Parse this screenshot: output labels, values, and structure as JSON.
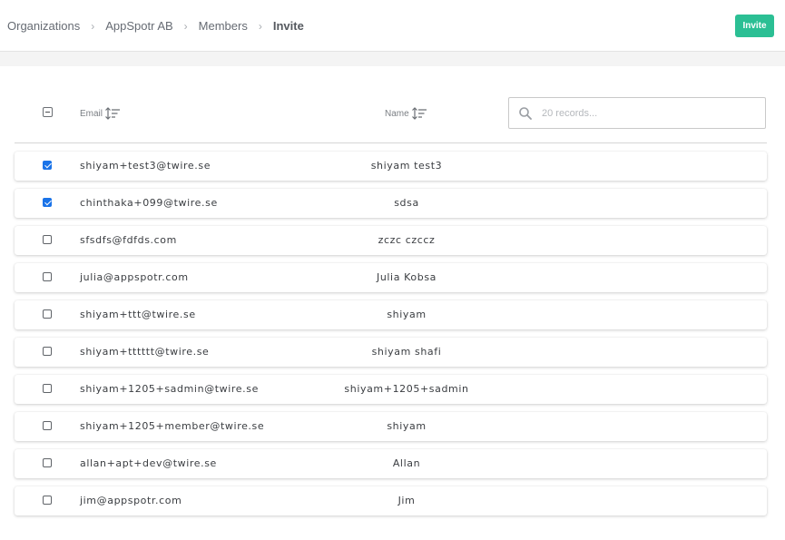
{
  "breadcrumb": {
    "items": [
      "Organizations",
      "AppSpotr AB",
      "Members"
    ],
    "current": "Invite",
    "separator": "›"
  },
  "toolbar": {
    "invite_label": "Invite"
  },
  "table": {
    "columns": {
      "email": "Email",
      "name": "Name"
    },
    "search": {
      "placeholder": "20 records..."
    },
    "rows": [
      {
        "email": "shiyam+test3@twire.se",
        "name": "shiyam test3",
        "checked": true
      },
      {
        "email": "chinthaka+099@twire.se",
        "name": "sdsa",
        "checked": true
      },
      {
        "email": "sfsdfs@fdfds.com",
        "name": "zczc czccz",
        "checked": false
      },
      {
        "email": "julia@appspotr.com",
        "name": "Julia Kobsa",
        "checked": false
      },
      {
        "email": "shiyam+ttt@twire.se",
        "name": "shiyam",
        "checked": false
      },
      {
        "email": "shiyam+tttttt@twire.se",
        "name": "shiyam shafi",
        "checked": false
      },
      {
        "email": "shiyam+1205+sadmin@twire.se",
        "name": "shiyam+1205+sadmin",
        "checked": false
      },
      {
        "email": "shiyam+1205+member@twire.se",
        "name": "shiyam",
        "checked": false
      },
      {
        "email": "allan+apt+dev@twire.se",
        "name": "Allan",
        "checked": false
      },
      {
        "email": "jim@appspotr.com",
        "name": "Jim",
        "checked": false
      }
    ]
  },
  "colors": {
    "accent": "#2bbf94",
    "checkbox": "#1a73e8"
  }
}
